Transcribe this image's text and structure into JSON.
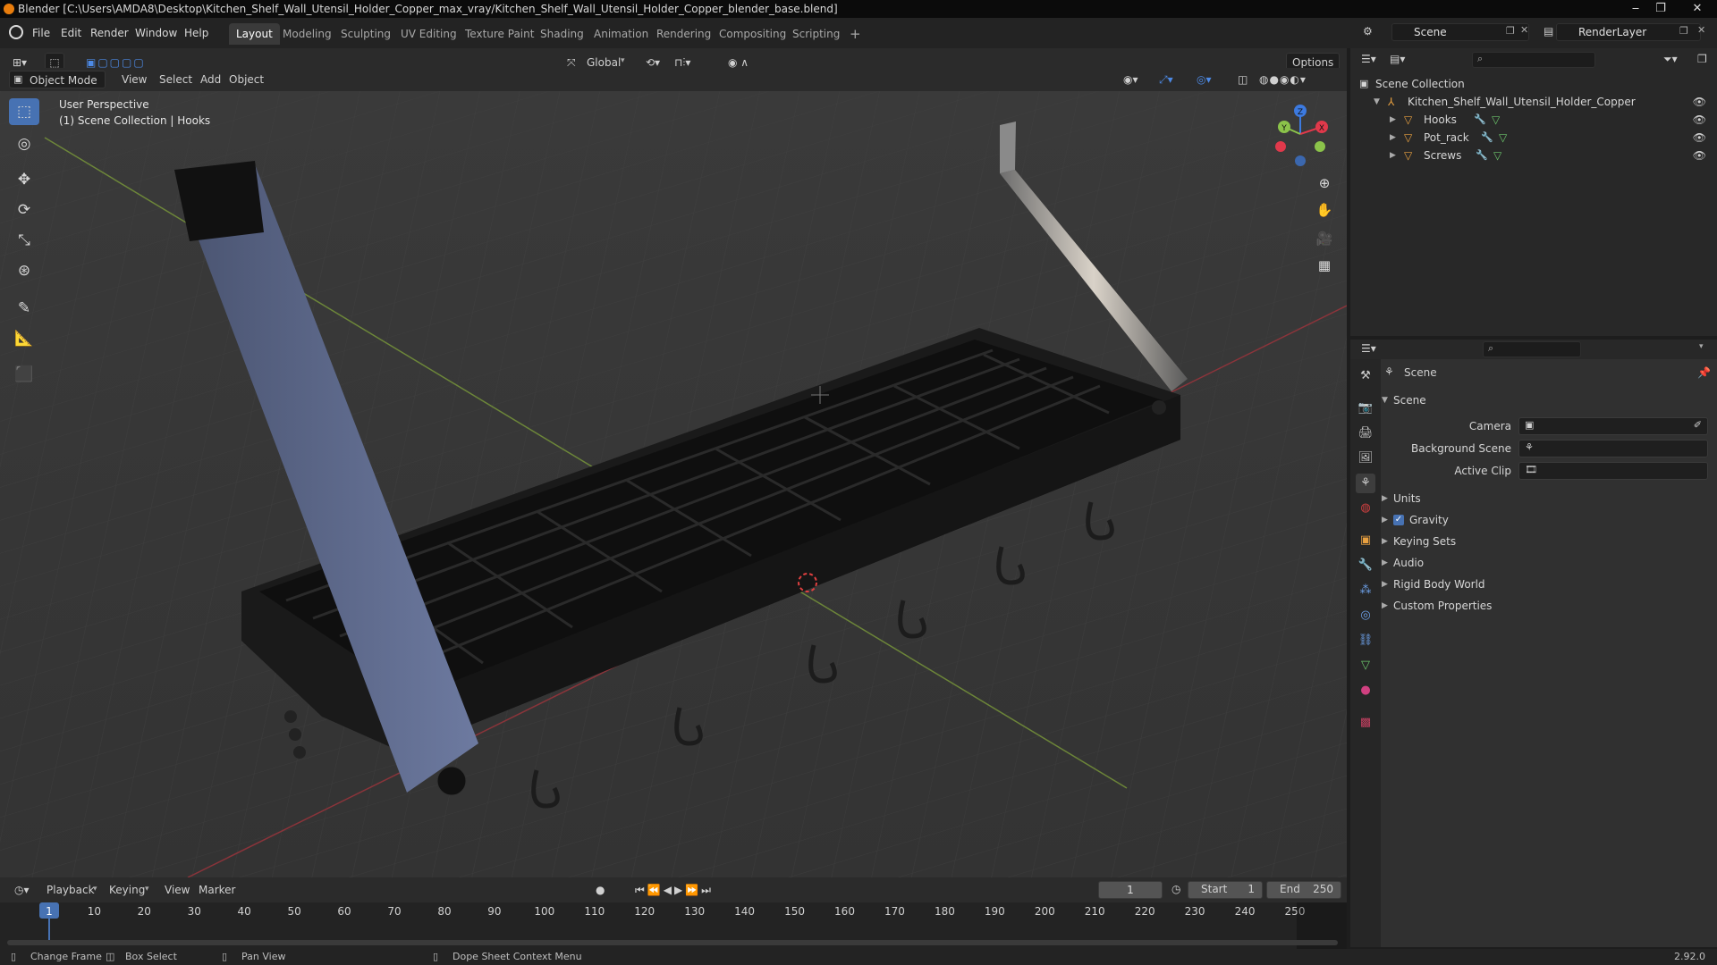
{
  "window": {
    "title": "Blender [C:\\Users\\AMDA8\\Desktop\\Kitchen_Shelf_Wall_Utensil_Holder_Copper_max_vray/Kitchen_Shelf_Wall_Utensil_Holder_Copper_blender_base.blend]",
    "minimize": "‒",
    "maximize": "❐",
    "close": "✕"
  },
  "menu": [
    "File",
    "Edit",
    "Render",
    "Window",
    "Help"
  ],
  "workspaces": [
    {
      "label": "Layout",
      "active": true
    },
    {
      "label": "Modeling"
    },
    {
      "label": "Sculpting"
    },
    {
      "label": "UV Editing"
    },
    {
      "label": "Texture Paint"
    },
    {
      "label": "Shading"
    },
    {
      "label": "Animation"
    },
    {
      "label": "Rendering"
    },
    {
      "label": "Compositing"
    },
    {
      "label": "Scripting"
    }
  ],
  "add_workspace": "+",
  "scene_field": "Scene",
  "renderlayer_field": "RenderLayer",
  "viewport": {
    "mode": "Object Mode",
    "menus": [
      "View",
      "Select",
      "Add",
      "Object"
    ],
    "orientation": "Global",
    "options": "Options",
    "overlay_line1": "User Perspective",
    "overlay_line2": "(1) Scene Collection | Hooks",
    "gizmo": {
      "x": "X",
      "y": "Y",
      "z": "Z"
    }
  },
  "outliner": {
    "root": "Scene Collection",
    "collection": "Kitchen_Shelf_Wall_Utensil_Holder_Copper",
    "objects": [
      "Hooks",
      "Pot_rack",
      "Screws"
    ]
  },
  "properties": {
    "context": "Scene",
    "section": "Scene",
    "fields": [
      {
        "label": "Camera"
      },
      {
        "label": "Background Scene"
      },
      {
        "label": "Active Clip"
      }
    ],
    "panels": [
      {
        "label": "Units"
      },
      {
        "label": "Gravity",
        "checkbox": true
      },
      {
        "label": "Keying Sets"
      },
      {
        "label": "Audio"
      },
      {
        "label": "Rigid Body World"
      },
      {
        "label": "Custom Properties"
      }
    ]
  },
  "timeline": {
    "menus": [
      "Playback",
      "Keying",
      "View",
      "Marker"
    ],
    "current_frame": "1",
    "start_label": "Start",
    "start": "1",
    "end_label": "End",
    "end": "250",
    "ticks": [
      "1",
      "10",
      "20",
      "30",
      "40",
      "50",
      "60",
      "70",
      "80",
      "90",
      "100",
      "110",
      "120",
      "130",
      "140",
      "150",
      "160",
      "170",
      "180",
      "190",
      "200",
      "210",
      "220",
      "230",
      "240",
      "250"
    ]
  },
  "statusbar": {
    "change_frame": "Change Frame",
    "box_select": "Box Select",
    "pan_view": "Pan View",
    "context_menu": "Dope Sheet Context Menu",
    "version": "2.92.0"
  },
  "colors": {
    "accent": "#4772b3",
    "active_frame": "#4772b3",
    "x_axis": "#e0394b",
    "y_axis": "#8bc34a",
    "z_axis": "#3c7ae0"
  }
}
